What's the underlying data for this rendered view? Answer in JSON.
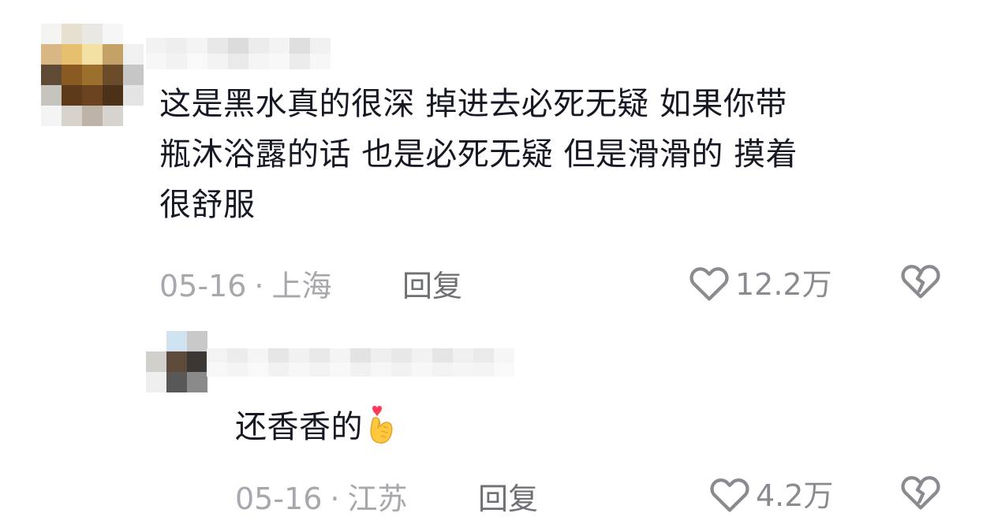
{
  "comments": [
    {
      "text": "这是黑水真的很深 掉进去必死无疑 如果你带\n瓶沐浴露的话 也是必死无疑 但是滑滑的 摸着\n很舒服",
      "date": "05-16",
      "location": "上海",
      "separator": "·",
      "reply_label": "回复",
      "like_count": "12.2万"
    },
    {
      "text": "还香香的",
      "emoji": "heart-finger",
      "date": "05-16",
      "location": "江苏",
      "separator": "·",
      "reply_label": "回复",
      "like_count": "4.2万"
    }
  ],
  "colors": {
    "text": "#161823",
    "meta": "#a7a8ad",
    "reply": "#6f7075",
    "icon": "#8a8b90",
    "emoji_heart": "#ff3b5c",
    "emoji_hand": "#ffc83d"
  }
}
